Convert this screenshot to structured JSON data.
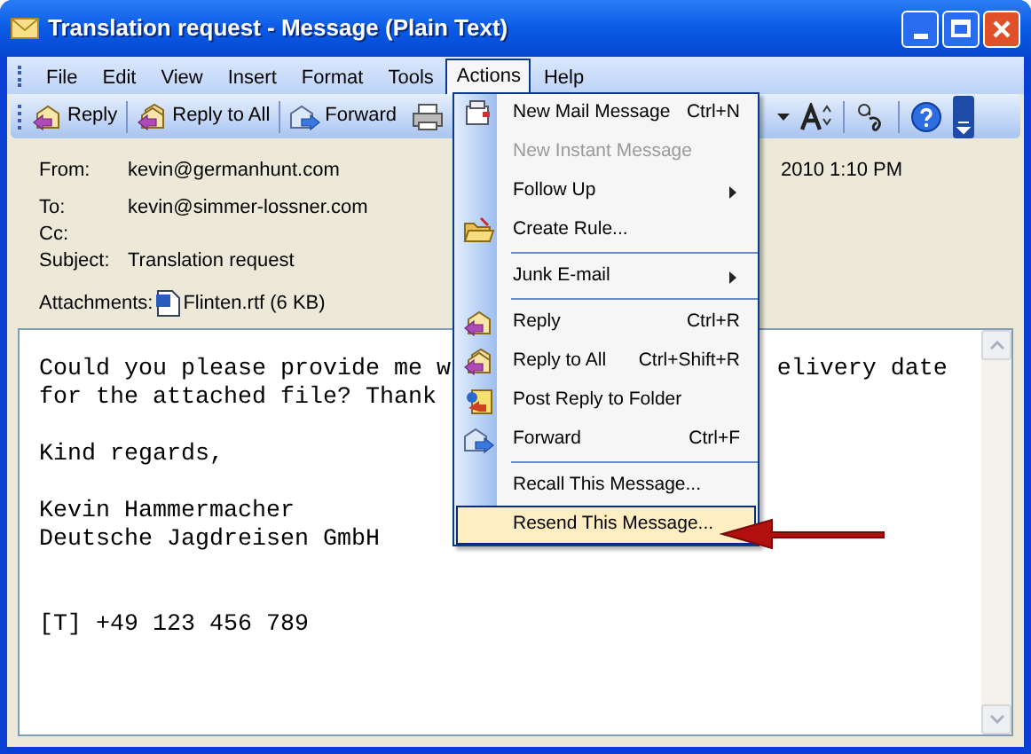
{
  "window": {
    "title": "Translation request - Message (Plain Text)"
  },
  "menubar": [
    {
      "label": "File",
      "selected": false
    },
    {
      "label": "Edit",
      "selected": false
    },
    {
      "label": "View",
      "selected": false
    },
    {
      "label": "Insert",
      "selected": false
    },
    {
      "label": "Format",
      "selected": false
    },
    {
      "label": "Tools",
      "selected": false
    },
    {
      "label": "Actions",
      "selected": true
    },
    {
      "label": "Help",
      "selected": false
    }
  ],
  "toolbar": [
    {
      "label": "Reply"
    },
    {
      "label": "Reply to All"
    },
    {
      "label": "Forward"
    }
  ],
  "header": {
    "from": {
      "label": "From:",
      "value": "kevin@germanhunt.com"
    },
    "sent": "2010 1:10 PM",
    "to": {
      "label": "To:",
      "value": "kevin@simmer-lossner.com"
    },
    "cc": {
      "label": "Cc:"
    },
    "subject": {
      "label": "Subject:",
      "value": "Translation request"
    },
    "attachments": {
      "label": "Attachments:",
      "file": "Flinten.rtf (6 KB)"
    }
  },
  "body": [
    {
      "kind": "text",
      "left": "Could you please provide me w",
      "right": "elivery date"
    },
    {
      "kind": "text",
      "left": "for the attached file? Thank"
    },
    {
      "kind": "blank"
    },
    {
      "kind": "text",
      "left": "Kind regards,"
    },
    {
      "kind": "blank"
    },
    {
      "kind": "text",
      "left": "Kevin Hammermacher"
    },
    {
      "kind": "text",
      "left": "Deutsche Jagdreisen GmbH"
    },
    {
      "kind": "blank"
    },
    {
      "kind": "blank"
    },
    {
      "kind": "text",
      "left": "[T] +49 123 456 789"
    }
  ],
  "menu": [
    {
      "kind": "item",
      "label": "New Mail Message",
      "shortcut": "Ctrl+N",
      "disabled": false,
      "submenu": false,
      "selected": false
    },
    {
      "kind": "item",
      "label": "New Instant Message",
      "disabled": true,
      "submenu": false,
      "selected": false
    },
    {
      "kind": "item",
      "label": "Follow Up",
      "disabled": false,
      "submenu": true,
      "selected": false
    },
    {
      "kind": "item",
      "label": "Create Rule...",
      "disabled": false,
      "submenu": false,
      "selected": false
    },
    {
      "kind": "separator"
    },
    {
      "kind": "item",
      "label": "Junk E-mail",
      "disabled": false,
      "submenu": true,
      "selected": false
    },
    {
      "kind": "separator"
    },
    {
      "kind": "item",
      "label": "Reply",
      "shortcut": "Ctrl+R",
      "disabled": false,
      "submenu": false,
      "selected": false
    },
    {
      "kind": "item",
      "label": "Reply to All",
      "shortcut": "Ctrl+Shift+R",
      "disabled": false,
      "submenu": false,
      "selected": false
    },
    {
      "kind": "item",
      "label": "Post Reply to Folder",
      "disabled": false,
      "submenu": false,
      "selected": false
    },
    {
      "kind": "item",
      "label": "Forward",
      "shortcut": "Ctrl+F",
      "disabled": false,
      "submenu": false,
      "selected": false
    },
    {
      "kind": "separator"
    },
    {
      "kind": "item",
      "label": "Recall This Message...",
      "disabled": false,
      "submenu": false,
      "selected": false
    },
    {
      "kind": "item",
      "label": "Resend This Message...",
      "disabled": false,
      "submenu": false,
      "selected": true
    }
  ]
}
